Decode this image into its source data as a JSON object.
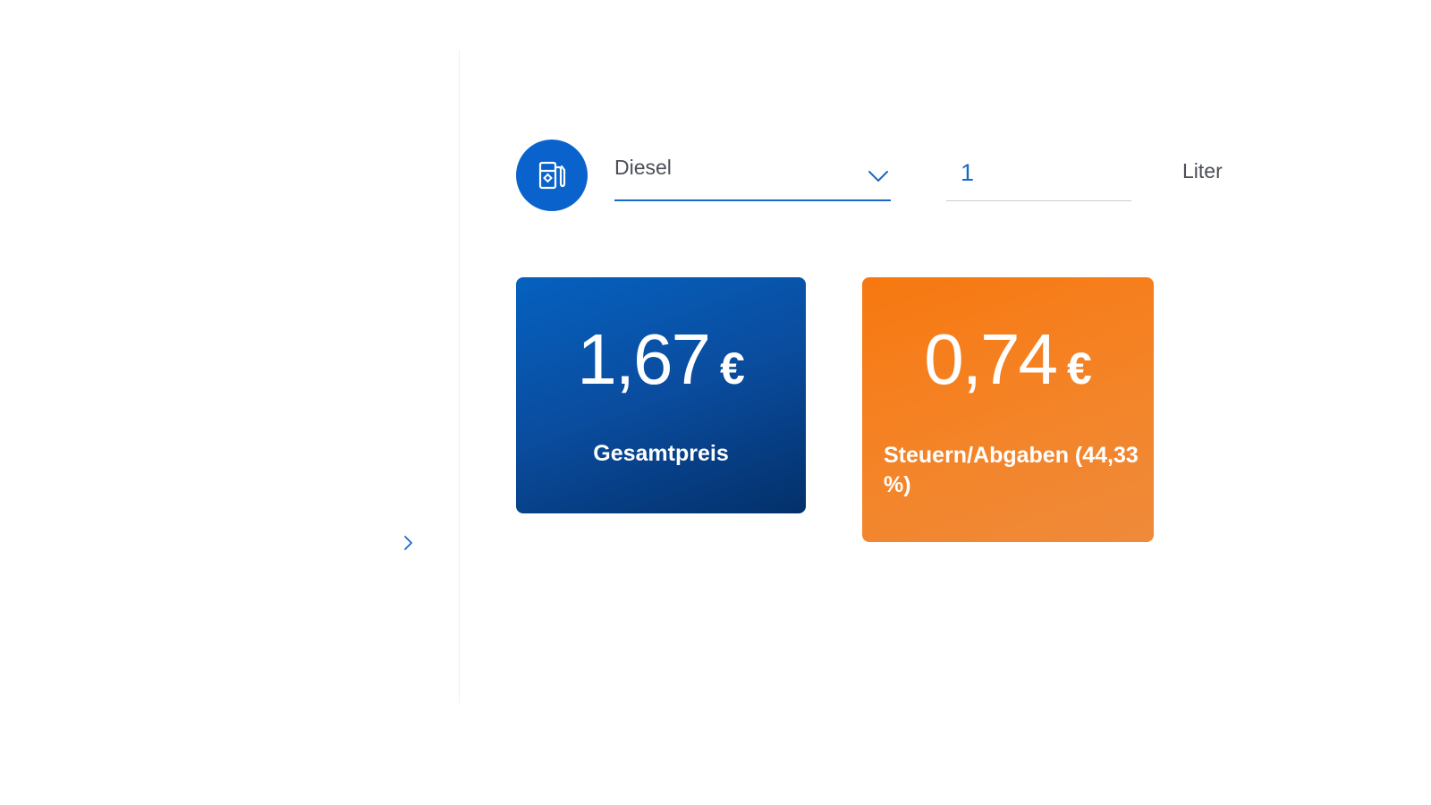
{
  "controls": {
    "fuel_icon": "fuel-pump-icon",
    "fuel_select_value": "Diesel",
    "quantity_value": "1",
    "quantity_unit": "Liter"
  },
  "cards": {
    "total": {
      "amount": "1,67",
      "currency": "€",
      "label": "Gesamtpreis",
      "color": "#0a4c9e"
    },
    "tax": {
      "amount": "0,74",
      "currency": "€",
      "label": "Steuern/Abgaben (44,33 %)",
      "color": "#f47b1c"
    }
  },
  "colors": {
    "accent": "#0a63cc",
    "text": "#4b4f57"
  }
}
